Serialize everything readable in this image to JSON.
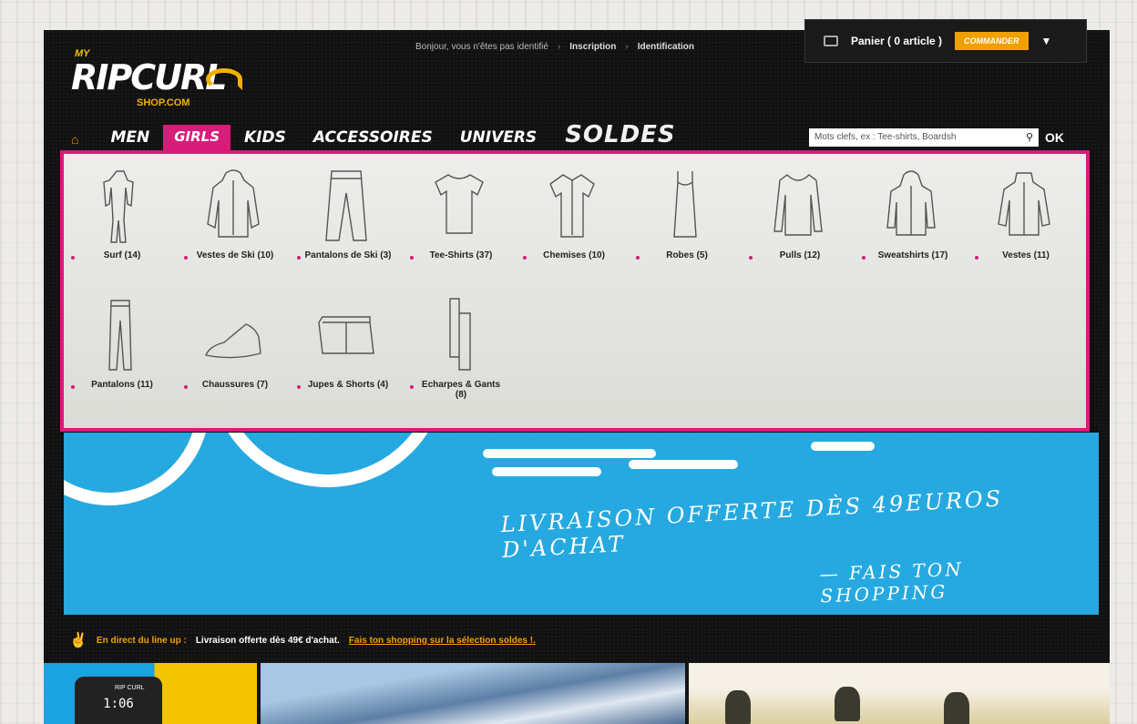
{
  "header": {
    "logo_my": "MY",
    "logo_brand": "RIPCURL",
    "logo_shop": "SHOP.COM",
    "greeting": "Bonjour, vous n'êtes pas identifié",
    "register_link": "Inscription",
    "login_link": "Identification",
    "cart_label": "Panier ( 0 article )",
    "order_button": "COMMANDER"
  },
  "nav": {
    "items": [
      {
        "label": "MEN"
      },
      {
        "label": "GIRLS"
      },
      {
        "label": "KIDS"
      },
      {
        "label": "ACCESSOIRES"
      },
      {
        "label": "UNIVERS"
      },
      {
        "label": "SOLDES"
      }
    ],
    "active": "GIRLS"
  },
  "search": {
    "placeholder": "Mots clefs, ex : Tee-shirts, Boardsh",
    "ok_label": "OK"
  },
  "dropdown": {
    "row1": [
      {
        "label": "Surf (14)",
        "icon": "wetsuit-icon"
      },
      {
        "label": "Vestes de Ski (10)",
        "icon": "ski-jacket-icon"
      },
      {
        "label": "Pantalons de Ski (3)",
        "icon": "ski-pants-icon"
      },
      {
        "label": "Tee-Shirts (37)",
        "icon": "tshirt-icon"
      },
      {
        "label": "Chemises (10)",
        "icon": "shirt-icon"
      },
      {
        "label": "Robes (5)",
        "icon": "dress-icon"
      },
      {
        "label": "Pulls (12)",
        "icon": "sweater-icon"
      },
      {
        "label": "Sweatshirts (17)",
        "icon": "hoodie-icon"
      },
      {
        "label": "Vestes (11)",
        "icon": "jacket-icon"
      }
    ],
    "row2": [
      {
        "label": "Pantalons (11)",
        "icon": "pants-icon"
      },
      {
        "label": "Chaussures (7)",
        "icon": "shoe-icon"
      },
      {
        "label": "Jupes & Shorts (4)",
        "icon": "shorts-icon"
      },
      {
        "label": "Echarpes & Gants (8)",
        "icon": "scarf-icon"
      }
    ]
  },
  "hero": {
    "promo_line1": "LIVRAISON OFFERTE DÈS 49EUROS D'ACHAT",
    "promo_line2": "— FAIS TON SHOPPING"
  },
  "ticker": {
    "prefix": "En direct du line up :",
    "text": "Livraison offerte dès 49€ d'achat.",
    "link": "Fais ton shopping sur la sélection soldes !."
  },
  "tiles": {
    "watch_brand": "RIP CURL",
    "watch_display": "1:06"
  },
  "colors": {
    "accent_pink": "#d71c7a",
    "accent_orange": "#f2a000",
    "hero_blue": "#26a9e0"
  }
}
